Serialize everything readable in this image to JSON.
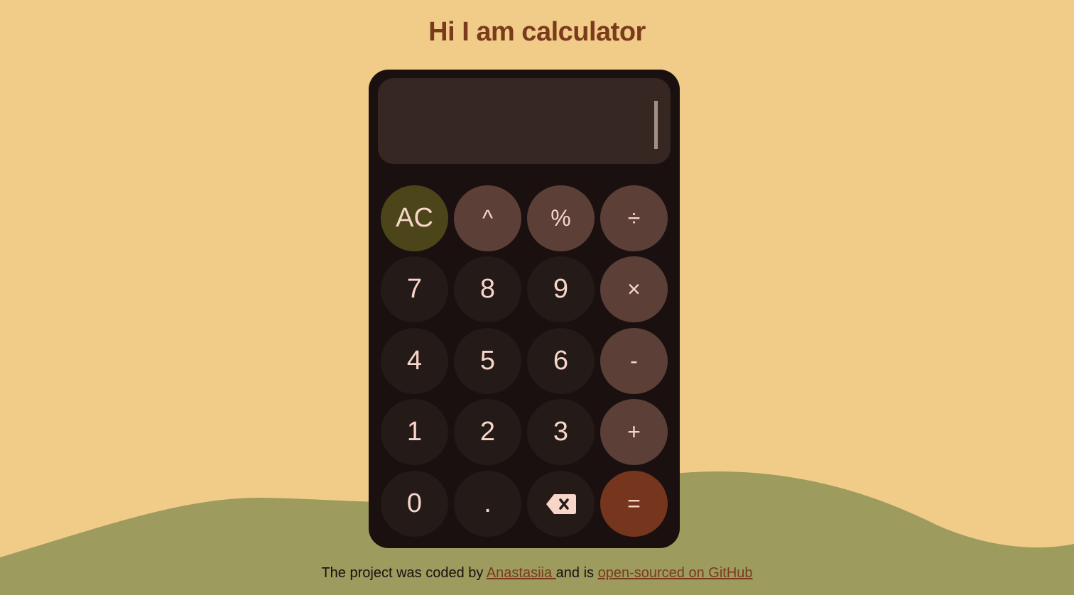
{
  "page": {
    "title": "Hi I am calculator",
    "background_color": "#f1cc88",
    "wave_color": "#9d9b5e"
  },
  "display": {
    "value": ""
  },
  "keys": {
    "clear": "AC",
    "power": "^",
    "percent": "%",
    "divide": "÷",
    "seven": "7",
    "eight": "8",
    "nine": "9",
    "multiply": "×",
    "four": "4",
    "five": "5",
    "six": "6",
    "minus": "-",
    "one": "1",
    "two": "2",
    "three": "3",
    "plus": "+",
    "zero": "0",
    "decimal": ".",
    "backspace_icon": "backspace-icon",
    "equals": "="
  },
  "colors": {
    "calculator_body": "#1a100f",
    "display_bg": "#372722",
    "number_key": "#241a18",
    "operator_key": "#5c4038",
    "clear_key": "#4c4519",
    "equals_key": "#76351d",
    "key_text": "#f7d5c9",
    "accent_text": "#7a3a1c"
  },
  "footer": {
    "prefix": "The project was coded by ",
    "author_link": "Anastasiia ",
    "middle": "and is ",
    "github_link": "open-sourced on GitHub"
  }
}
